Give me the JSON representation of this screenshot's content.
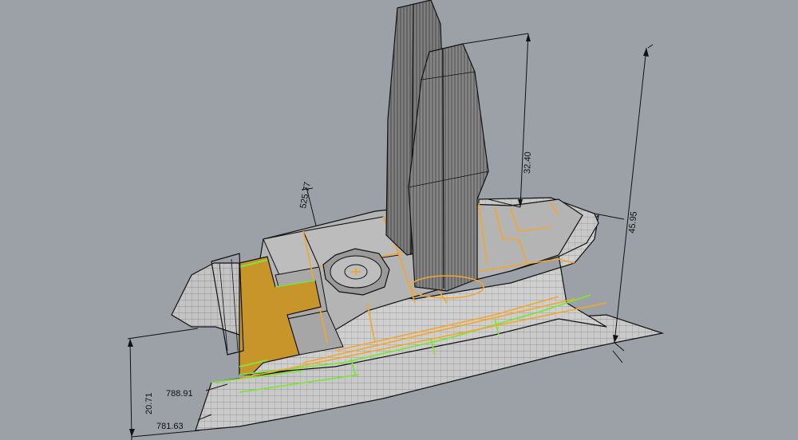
{
  "viewport": {
    "background": "#9ba1a7",
    "colors": {
      "wire": "#1a1a1a",
      "hull": "#c9c9c9",
      "deck": "#a9a9a9",
      "accent_orange": "#f3a72a",
      "accent_green": "#7fe33a",
      "aft_deck": "#c8952b",
      "sail": "#777777"
    }
  },
  "dimensions": {
    "d1": "525.77",
    "d2": "32.40",
    "d3": "45.95",
    "d4": "20.71",
    "d5": "788.91",
    "d6": "781.63"
  }
}
